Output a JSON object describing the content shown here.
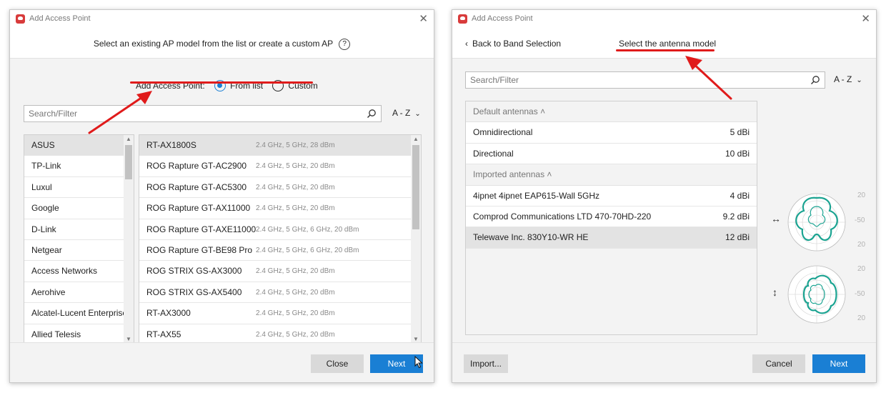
{
  "left": {
    "title": "Add Access Point",
    "instruction": "Select an existing AP model from the list or create a custom AP",
    "help_icon": "?",
    "mode_label": "Add Access Point:",
    "mode_options": [
      {
        "label": "From list",
        "checked": true
      },
      {
        "label": "Custom",
        "checked": false
      }
    ],
    "search_placeholder": "Search/Filter",
    "sort": "A - Z",
    "vendors": [
      "ASUS",
      "TP-Link",
      "Luxul",
      "Google",
      "D-Link",
      "Netgear",
      "Access Networks",
      "Aerohive",
      "Alcatel-Lucent Enterprise",
      "Allied Telesis"
    ],
    "selected_vendor_index": 0,
    "models": [
      {
        "name": "RT-AX1800S",
        "meta": "2.4 GHz, 5 GHz, 28 dBm"
      },
      {
        "name": "ROG Rapture GT-AC2900",
        "meta": "2.4 GHz, 5 GHz, 20 dBm"
      },
      {
        "name": "ROG Rapture GT-AC5300",
        "meta": "2.4 GHz, 5 GHz, 20 dBm"
      },
      {
        "name": "ROG Rapture GT-AX11000",
        "meta": "2.4 GHz, 5 GHz, 20 dBm"
      },
      {
        "name": "ROG Rapture GT-AXE11000",
        "meta": "2.4 GHz, 5 GHz, 6 GHz, 20 dBm"
      },
      {
        "name": "ROG Rapture GT-BE98 Pro",
        "meta": "2.4 GHz, 5 GHz, 6 GHz, 20 dBm"
      },
      {
        "name": "ROG STRIX GS-AX3000",
        "meta": "2.4 GHz, 5 GHz, 20 dBm"
      },
      {
        "name": "ROG STRIX GS-AX5400",
        "meta": "2.4 GHz, 5 GHz, 20 dBm"
      },
      {
        "name": "RT-AX3000",
        "meta": "2.4 GHz, 5 GHz, 20 dBm"
      },
      {
        "name": "RT-AX55",
        "meta": "2.4 GHz, 5 GHz, 20 dBm"
      }
    ],
    "selected_model_index": 0,
    "close_label": "Close",
    "next_label": "Next"
  },
  "right": {
    "title": "Add Access Point",
    "back_label": "Back to Band Selection",
    "header_title": "Select the antenna model",
    "search_placeholder": "Search/Filter",
    "sort": "A - Z",
    "groups": [
      {
        "label": "Default antennas",
        "items": [
          {
            "name": "Omnidirectional",
            "gain": "5 dBi"
          },
          {
            "name": "Directional",
            "gain": "10 dBi"
          }
        ]
      },
      {
        "label": "Imported antennas",
        "items": [
          {
            "name": "4ipnet 4ipnet EAP615-Wall 5GHz",
            "gain": "4 dBi"
          },
          {
            "name": "Comprod Communications LTD 470-70HD-220",
            "gain": "9.2 dBi"
          },
          {
            "name": "Telewave Inc. 830Y10-WR HE",
            "gain": "12 dBi",
            "selected": true
          }
        ]
      }
    ],
    "polar_top_labels": [
      "20",
      "-50",
      "20"
    ],
    "polar_bottom_labels": [
      "20",
      "-50",
      "20"
    ],
    "import_label": "Import...",
    "cancel_label": "Cancel",
    "next_label": "Next"
  },
  "colors": {
    "accent": "#1a7fd4",
    "annotation_red": "#e01b1b",
    "pattern_teal": "#1aa391"
  }
}
